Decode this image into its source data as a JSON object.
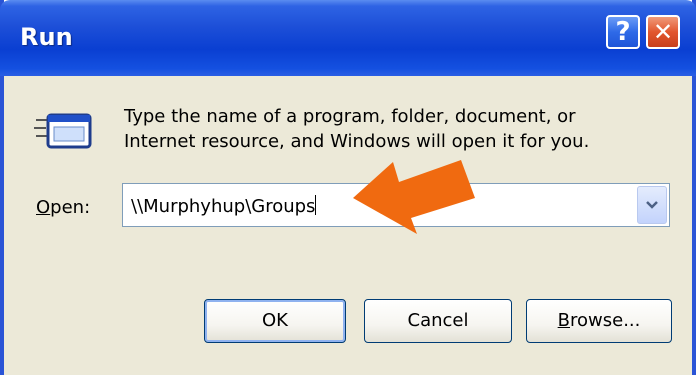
{
  "window": {
    "title": "Run",
    "help_label": "?",
    "close_label": "✕"
  },
  "icons": {
    "run": "run-program-icon",
    "dropdown": "chevron-down-icon",
    "annotation": "orange-arrow-icon"
  },
  "description": {
    "line1": "Type the name of a program, folder, document, or",
    "line2": "Internet resource, and Windows will open it for you."
  },
  "open_field": {
    "label_underlined": "O",
    "label_rest": "pen:",
    "value": "\\\\Murphyhup\\Groups"
  },
  "buttons": {
    "ok": "OK",
    "cancel": "Cancel",
    "browse_underlined": "B",
    "browse_rest": "rowse..."
  },
  "colors": {
    "titlebar": "#0a3fd2",
    "client_bg": "#ece9d8",
    "close_button": "#e2572e",
    "arrow": "#f06a10"
  }
}
